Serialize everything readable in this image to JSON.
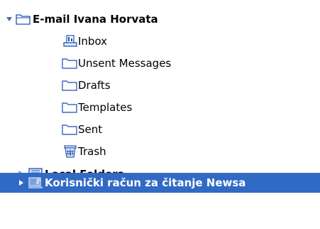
{
  "folder_tree": {
    "account": {
      "label": "E-mail Ivana Horvata",
      "expanded": true,
      "icon": "account-folder-icon",
      "folders": [
        {
          "label": "Inbox",
          "icon": "inbox-icon"
        },
        {
          "label": "Unsent Messages",
          "icon": "folder-icon"
        },
        {
          "label": "Drafts",
          "icon": "folder-icon"
        },
        {
          "label": "Templates",
          "icon": "folder-icon"
        },
        {
          "label": "Sent",
          "icon": "folder-icon"
        },
        {
          "label": "Trash",
          "icon": "trash-icon"
        }
      ]
    },
    "local_folders": {
      "label": "Local Folders",
      "expanded": false,
      "icon": "local-folders-icon"
    },
    "newsgroup_account": {
      "label": "Korisnički račun za čitanje Newsa",
      "expanded": false,
      "selected": true,
      "icon": "newsgroup-icon"
    }
  },
  "colors": {
    "selection_bg": "#316ac5",
    "selection_text": "#ffffff",
    "icon_blue": "#1c4fb3"
  }
}
